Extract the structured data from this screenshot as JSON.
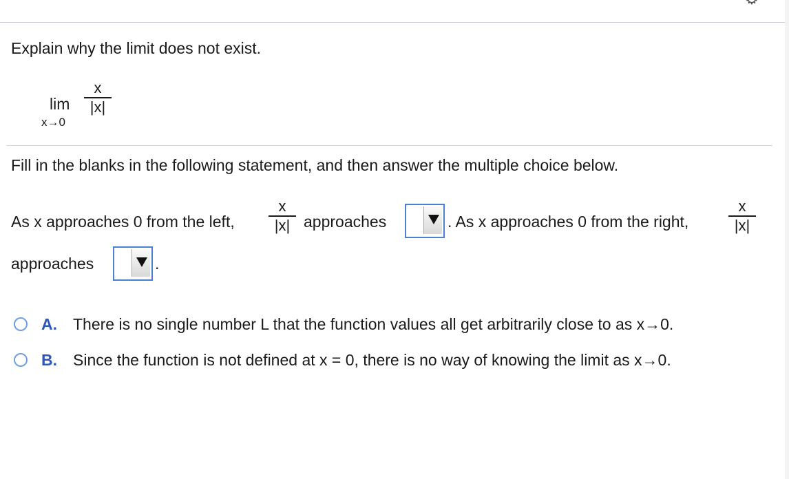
{
  "header": {
    "settings_icon": "gear-icon"
  },
  "question": {
    "prompt": "Explain why the limit does not exist.",
    "limit": {
      "lim": "lim",
      "approach": "x→0",
      "numerator": "x",
      "denominator": "|x|"
    }
  },
  "instructions": "Fill in the blanks in the following statement, and then answer the multiple choice below.",
  "statement": {
    "part1": "As x approaches 0 from the left,",
    "frac1_num": "x",
    "frac1_den": "|x|",
    "part2": "approaches",
    "part3": ". As x approaches 0 from the right,",
    "frac2_num": "x",
    "frac2_den": "|x|",
    "part4": "approaches",
    "part5": ".",
    "dropdown1_value": "",
    "dropdown2_value": ""
  },
  "choices": [
    {
      "letter": "A.",
      "text": "There is no single number L that the function values all get arbitrarily close to as x→0.",
      "selected": false
    },
    {
      "letter": "B.",
      "text": "Since the function is not defined at x = 0, there is no way of knowing the limit as x→0.",
      "selected": false
    }
  ],
  "colors": {
    "accent": "#2c56b8",
    "radio_border": "#6f9fe3",
    "dropdown_border": "#4a7fd4"
  }
}
